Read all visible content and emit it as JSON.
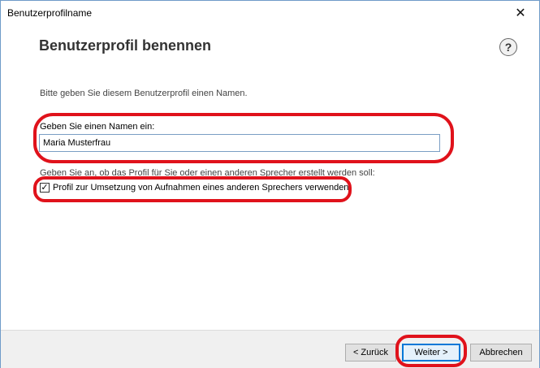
{
  "window": {
    "title": "Benutzerprofilname",
    "close_glyph": "✕"
  },
  "page": {
    "heading": "Benutzerprofil benennen",
    "help_glyph": "?",
    "instruction": "Bitte geben Sie diesem Benutzerprofil einen Namen."
  },
  "name_field": {
    "label": "Geben Sie einen Namen ein:",
    "value": "Maria Musterfrau"
  },
  "speaker": {
    "label": "Geben Sie an, ob das Profil für Sie oder einen anderen Sprecher erstellt werden soll:",
    "checkbox_label": "Profil zur Umsetzung von Aufnahmen eines anderen Sprechers verwenden",
    "checked": true,
    "check_glyph": "✓"
  },
  "buttons": {
    "back": "< Zurück",
    "next": "Weiter >",
    "cancel": "Abbrechen"
  },
  "colors": {
    "annotation": "#e0121b",
    "accent": "#0078d7"
  }
}
